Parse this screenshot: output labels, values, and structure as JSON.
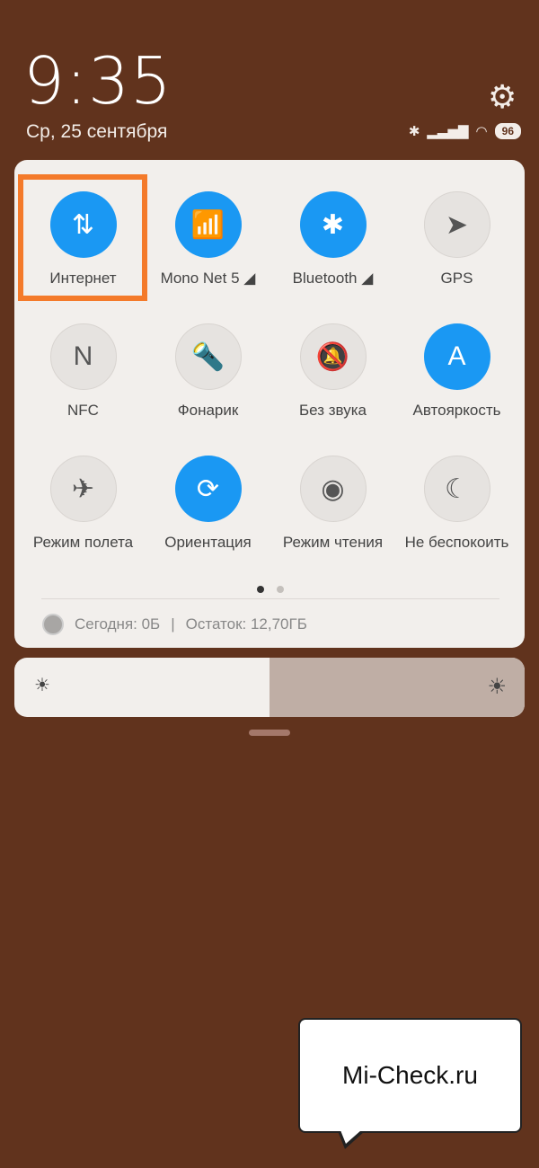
{
  "header": {
    "time": "9:35",
    "date": "Ср, 25 сентября",
    "battery": "96"
  },
  "tiles": [
    {
      "label": "Интернет",
      "icon": "mobile-data-icon",
      "glyph": "⇅",
      "on": true
    },
    {
      "label": "Mono Net 5 ◢",
      "icon": "wifi-icon",
      "glyph": "📶",
      "on": true
    },
    {
      "label": "Bluetooth ◢",
      "icon": "bluetooth-icon",
      "glyph": "✱",
      "on": true
    },
    {
      "label": "GPS",
      "icon": "location-arrow-icon",
      "glyph": "➤",
      "on": false
    },
    {
      "label": "NFC",
      "icon": "nfc-icon",
      "glyph": "N",
      "on": false
    },
    {
      "label": "Фонарик",
      "icon": "flashlight-icon",
      "glyph": "🔦",
      "on": false
    },
    {
      "label": "Без звука",
      "icon": "bell-off-icon",
      "glyph": "🔕",
      "on": false
    },
    {
      "label": "Автояркость",
      "icon": "auto-brightness-icon",
      "glyph": "A",
      "on": true
    },
    {
      "label": "Режим полета",
      "icon": "airplane-icon",
      "glyph": "✈",
      "on": false
    },
    {
      "label": "Ориентация",
      "icon": "rotation-lock-icon",
      "glyph": "⟳",
      "on": true
    },
    {
      "label": "Режим чтения",
      "icon": "eye-icon",
      "glyph": "◉",
      "on": false
    },
    {
      "label": "Не беспокоить",
      "icon": "moon-icon",
      "glyph": "☾",
      "on": false
    }
  ],
  "usage": {
    "today": "Сегодня: 0Б",
    "divider": "|",
    "remaining": "Остаток: 12,70ГБ"
  },
  "brightness": 0.5,
  "page_indicator": {
    "current": 1,
    "total": 2
  },
  "callout": "Mi-Check.ru",
  "colors": {
    "active": "#1a98f3",
    "highlight": "#f47a2a",
    "background": "#61331d"
  }
}
